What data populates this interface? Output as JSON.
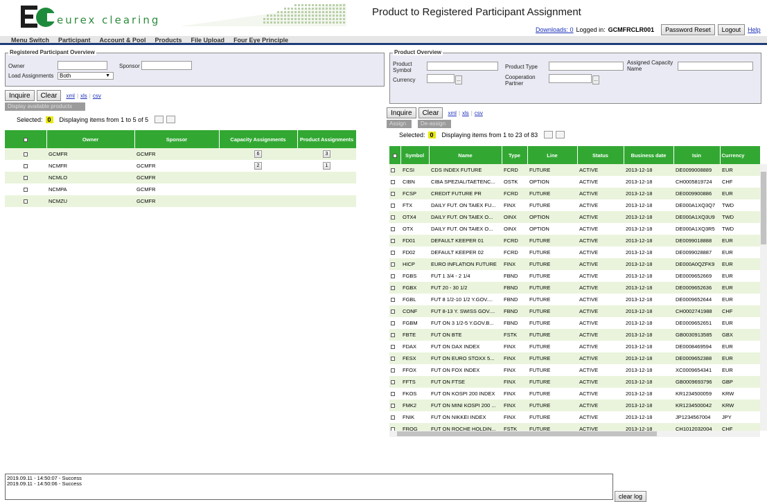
{
  "header": {
    "logo_text": "eurex clearing",
    "title": "Product to Registered Participant Assignment",
    "downloads_label": "Downloads: 0",
    "logged_in_label": "Logged in:",
    "user": "GCMFRCLR001",
    "password_reset": "Password Reset",
    "logout": "Logout",
    "help": "Help"
  },
  "menu": [
    "Menu Switch",
    "Participant",
    "Account & Pool",
    "Products",
    "File Upload",
    "Four Eye Principle"
  ],
  "left": {
    "legend": "Registered Participant Overview",
    "owner_label": "Owner",
    "sponsor_label": "Sponsor",
    "load_label": "Load Assignments",
    "load_value": "Both",
    "inquire": "Inquire",
    "clear": "Clear",
    "exports": [
      "xml",
      "xls",
      "csv"
    ],
    "display_available": "Display available products",
    "selected_label": "Selected:",
    "selected_count": "0",
    "displaying": "Displaying items from 1 to 5 of 5",
    "columns": [
      "Owner",
      "Sponsor",
      "Capacity Assignments",
      "Product Assignments"
    ],
    "rows": [
      {
        "owner": "GCMFR",
        "sponsor": "GCMFR",
        "capacity": "6",
        "product": "3"
      },
      {
        "owner": "NCMFR",
        "sponsor": "GCMFR",
        "capacity": "2",
        "product": "1"
      },
      {
        "owner": "NCMLO",
        "sponsor": "GCMFR",
        "capacity": "",
        "product": ""
      },
      {
        "owner": "NCMPA",
        "sponsor": "GCMFR",
        "capacity": "",
        "product": ""
      },
      {
        "owner": "NCMZU",
        "sponsor": "GCMFR",
        "capacity": "",
        "product": ""
      }
    ]
  },
  "right": {
    "legend": "Product Overview",
    "product_symbol_label": "Product Symbol",
    "product_type_label": "Product Type",
    "assigned_capacity_label": "Assigned Capacity Name",
    "currency_label": "Currency",
    "cooperation_label": "Cooperation Partner",
    "inquire": "Inquire",
    "clear": "Clear",
    "exports": [
      "xml",
      "xls",
      "csv"
    ],
    "assign": "Assign",
    "deassign": "De-assign",
    "selected_label": "Selected:",
    "selected_count": "0",
    "displaying": "Displaying items from 1 to 23 of 83",
    "columns": [
      "Symbol",
      "Name",
      "Type",
      "Line",
      "Status",
      "Business date",
      "Isin",
      "Currency"
    ],
    "rows": [
      [
        "FCSI",
        "CDS INDEX FUTURE",
        "FCRD",
        "FUTURE",
        "ACTIVE",
        "2013-12-18",
        "DE0099008889",
        "EUR"
      ],
      [
        "CIBN",
        "CIBA SPEZIALITAETENC...",
        "OSTK",
        "OPTION",
        "ACTIVE",
        "2013-12-18",
        "CH0005819724",
        "CHF"
      ],
      [
        "FCSP",
        "CREDIT FUTURE PR",
        "FCRD",
        "FUTURE",
        "ACTIVE",
        "2013-12-18",
        "DE0009900886",
        "EUR"
      ],
      [
        "FTX",
        "DAILY FUT. ON TAIEX FU...",
        "FINX",
        "FUTURE",
        "ACTIVE",
        "2013-12-18",
        "DE000A1XQ3Q7",
        "TWD"
      ],
      [
        "OTX4",
        "DAILY FUT. ON TAIEX O...",
        "OINX",
        "OPTION",
        "ACTIVE",
        "2013-12-18",
        "DE000A1XQ3U9",
        "TWD"
      ],
      [
        "OTX",
        "DAILY FUT. ON TAIEX O...",
        "OINX",
        "OPTION",
        "ACTIVE",
        "2013-12-18",
        "DE000A1XQ3R5",
        "TWD"
      ],
      [
        "FD01",
        "DEFAULT KEEPER 01",
        "FCRD",
        "FUTURE",
        "ACTIVE",
        "2013-12-18",
        "DE0099018888",
        "EUR"
      ],
      [
        "FD02",
        "DEFAULT KEEPER 02",
        "FCRD",
        "FUTURE",
        "ACTIVE",
        "2013-12-18",
        "DE0099028887",
        "EUR"
      ],
      [
        "HICP",
        "EURO INFLATION FUTURE",
        "FINX",
        "FUTURE",
        "ACTIVE",
        "2013-12-18",
        "DE000A0QZFK9",
        "EUR"
      ],
      [
        "FGBS",
        "FUT 1 3/4 - 2 1/4",
        "FBND",
        "FUTURE",
        "ACTIVE",
        "2013-12-18",
        "DE0009652669",
        "EUR"
      ],
      [
        "FGBX",
        "FUT 20 - 30 1/2",
        "FBND",
        "FUTURE",
        "ACTIVE",
        "2013-12-18",
        "DE0009652636",
        "EUR"
      ],
      [
        "FGBL",
        "FUT 8 1/2-10 1/2 Y.GOV....",
        "FBND",
        "FUTURE",
        "ACTIVE",
        "2013-12-18",
        "DE0009652644",
        "EUR"
      ],
      [
        "CONF",
        "FUT 8-13 Y. SWISS GOV....",
        "FBND",
        "FUTURE",
        "ACTIVE",
        "2013-12-18",
        "CH0002741988",
        "CHF"
      ],
      [
        "FGBM",
        "FUT ON 3 1/2-5 Y.GOV.B...",
        "FBND",
        "FUTURE",
        "ACTIVE",
        "2013-12-18",
        "DE0009652651",
        "EUR"
      ],
      [
        "FBTE",
        "FUT ON BTE",
        "FSTK",
        "FUTURE",
        "ACTIVE",
        "2013-12-18",
        "GB0030913585",
        "GBX"
      ],
      [
        "FDAX",
        "FUT ON DAX INDEX",
        "FINX",
        "FUTURE",
        "ACTIVE",
        "2013-12-18",
        "DE0008469594",
        "EUR"
      ],
      [
        "FESX",
        "FUT ON EURO STOXX 5...",
        "FINX",
        "FUTURE",
        "ACTIVE",
        "2013-12-18",
        "DE0009652388",
        "EUR"
      ],
      [
        "FFOX",
        "FUT ON FOX INDEX",
        "FINX",
        "FUTURE",
        "ACTIVE",
        "2013-12-18",
        "XC0009654341",
        "EUR"
      ],
      [
        "FFTS",
        "FUT ON FTSE",
        "FINX",
        "FUTURE",
        "ACTIVE",
        "2013-12-18",
        "GB0009693796",
        "GBP"
      ],
      [
        "FKOS",
        "FUT ON KOSPI 200 INDEX",
        "FINX",
        "FUTURE",
        "ACTIVE",
        "2013-12-18",
        "KR1234500059",
        "KRW"
      ],
      [
        "FMK2",
        "FUT ON MINI KOSPI 200 ...",
        "FINX",
        "FUTURE",
        "ACTIVE",
        "2013-12-18",
        "KR1234500042",
        "KRW"
      ],
      [
        "FNIK",
        "FUT ON NIKKEI INDEX",
        "FINX",
        "FUTURE",
        "ACTIVE",
        "2013-12-18",
        "JP1234567004",
        "JPY"
      ],
      [
        "FROG",
        "FUT ON ROCHE HOLDIN...",
        "FSTK",
        "FUTURE",
        "ACTIVE",
        "2013-12-18",
        "CH1012032004",
        "CHF"
      ]
    ]
  },
  "log": {
    "lines": [
      "2019.09.11 - 14:50:07 - Success",
      "2019.09.11 - 14:50:06 - Success"
    ],
    "clear_label": "clear log"
  }
}
